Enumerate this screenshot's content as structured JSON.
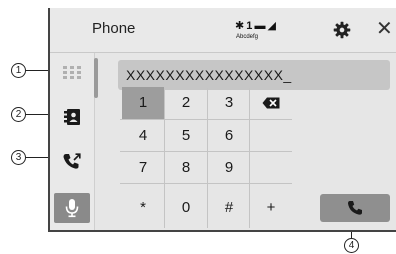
{
  "header": {
    "title": "Phone",
    "status_icons": "✱ 1 ▬ ◢",
    "status_label": "Abcdefg",
    "close_symbol": "✕"
  },
  "display": {
    "value": "XXXXXXXXXXXXXXXX_"
  },
  "keypad": {
    "keys": [
      "1",
      "2",
      "3",
      "4",
      "5",
      "6",
      "7",
      "8",
      "9",
      "*",
      "0",
      "#",
      "+"
    ],
    "selected": "1"
  },
  "callouts": [
    "1",
    "2",
    "3",
    "4"
  ],
  "sidebar": {
    "items": [
      {
        "icon": "dialpad-icon"
      },
      {
        "icon": "phonebook-icon"
      },
      {
        "icon": "call-history-icon"
      },
      {
        "icon": "microphone-icon"
      }
    ]
  },
  "colors": {
    "screen_bg": "#e6e6e6",
    "selected_key": "#9d9d9d",
    "display_bg": "#c6c6c6",
    "call_button": "#8f8f8f"
  }
}
